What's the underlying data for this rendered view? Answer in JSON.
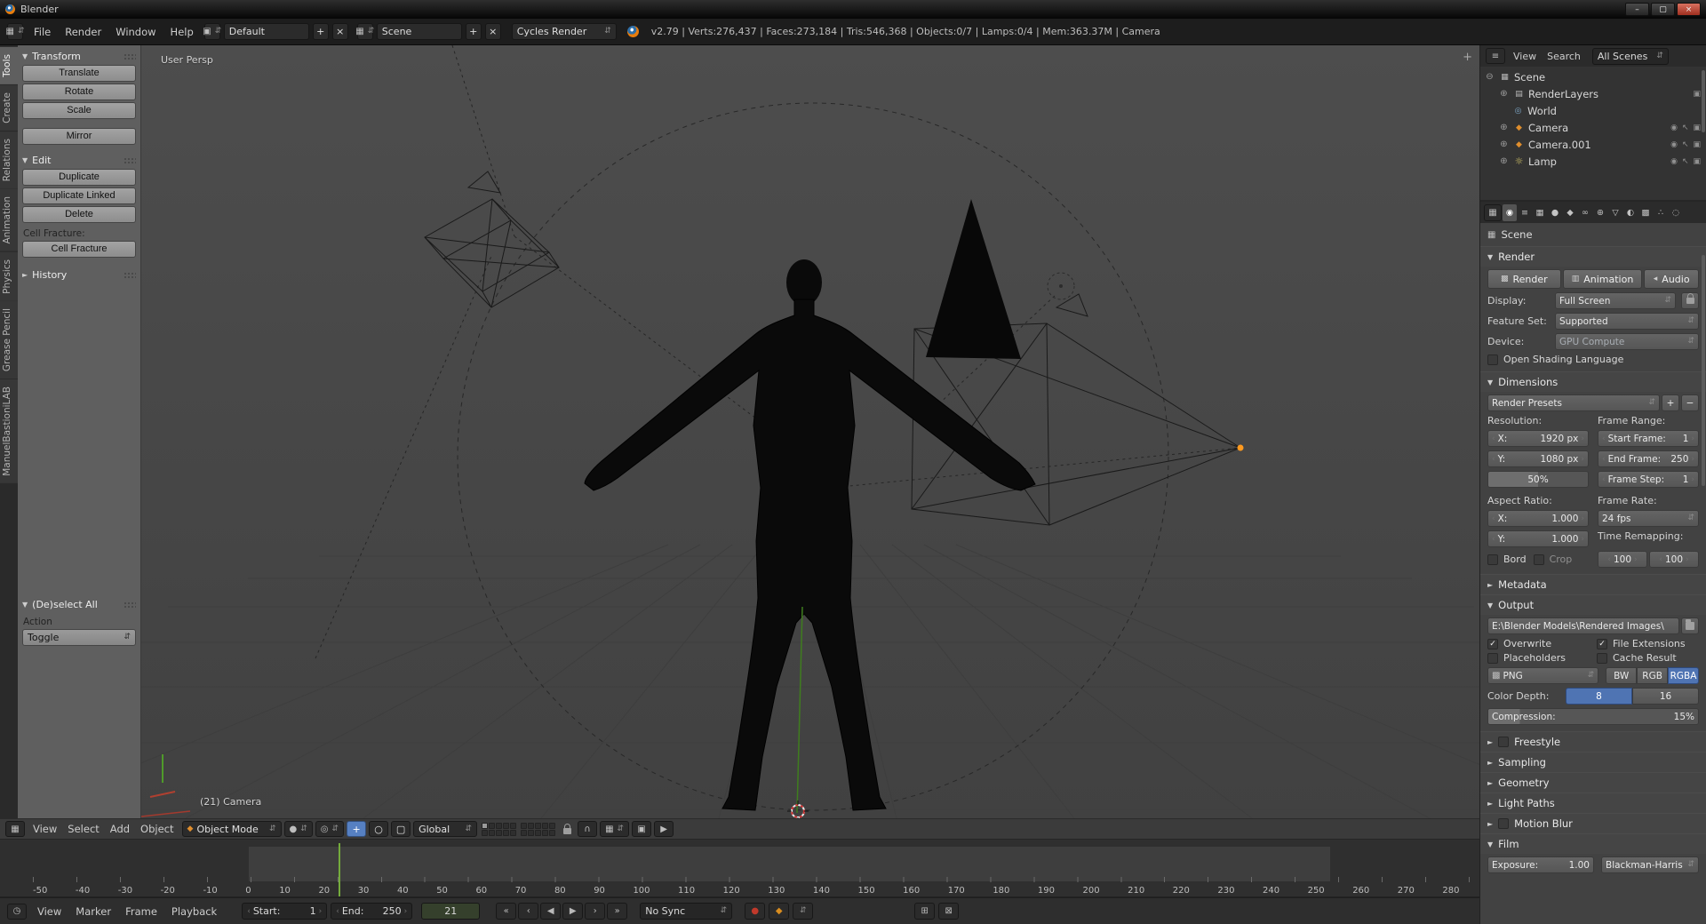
{
  "icons": {
    "updown": "⇵",
    "left": "‹",
    "right": "›",
    "check": "✓",
    "open": "▼",
    "closed": "►",
    "plus": "+",
    "minus": "−",
    "close": "×",
    "minimize": "–",
    "maximize": "▢",
    "expand": "⊕",
    "collapse": "⊖",
    "eye": "◉",
    "cursor": "↖",
    "render_restrict": "▣",
    "scene": "▦",
    "renderlayers": "▤",
    "world": "◎",
    "camera": "◆",
    "lamp": "☼",
    "editor_generic": "▦",
    "editor_timeline": "◷",
    "editor_outliner": "≡",
    "cube": "◆",
    "sphere": "●",
    "pivot": "◎",
    "manip_move": "+",
    "manip_rotate": "○",
    "manip_scale": "▢",
    "magnet": "∩",
    "snap": "▦",
    "ogl_camera": "▣",
    "ogl_anim": "▶",
    "record": "●",
    "keyframe": "◆",
    "keying": "⊞",
    "keying2": "⊠",
    "image": "▩",
    "anim_icon": "▥",
    "audio_icon": "◂"
  },
  "titlebar": {
    "title": "Blender"
  },
  "infobar": {
    "menus": [
      "File",
      "Render",
      "Window",
      "Help"
    ],
    "layout": "Default",
    "scene": "Scene",
    "engine": "Cycles Render",
    "stats": "v2.79 | Verts:276,437 | Faces:273,184 | Tris:546,368 | Objects:0/7 | Lamps:0/4 | Mem:363.37M | Camera"
  },
  "toolshelf": {
    "tabs": [
      "Tools",
      "Create",
      "Relations",
      "Animation",
      "Physics",
      "Grease Pencil",
      "ManuelBastioniLAB"
    ],
    "transform": {
      "title": "Transform",
      "buttons": [
        "Translate",
        "Rotate",
        "Scale"
      ],
      "mirror": "Mirror"
    },
    "edit": {
      "title": "Edit",
      "buttons": [
        "Duplicate",
        "Duplicate Linked",
        "Delete"
      ],
      "cell_label": "Cell Fracture:",
      "cell_btn": "Cell Fracture"
    },
    "history": "History",
    "redo": {
      "title": "(De)select All",
      "action_label": "Action",
      "value": "Toggle"
    }
  },
  "viewport": {
    "persp": "User Persp",
    "camera": "(21) Camera",
    "menus": [
      "View",
      "Select",
      "Add",
      "Object"
    ],
    "mode": "Object Mode",
    "orientation": "Global"
  },
  "timeline": {
    "ticks": [
      "-50",
      "-40",
      "-30",
      "-20",
      "-10",
      "0",
      "10",
      "20",
      "30",
      "40",
      "50",
      "60",
      "70",
      "80",
      "90",
      "100",
      "110",
      "120",
      "130",
      "140",
      "150",
      "160",
      "170",
      "180",
      "190",
      "200",
      "210",
      "220",
      "230",
      "240",
      "250",
      "260",
      "270",
      "280"
    ],
    "menus": [
      "View",
      "Marker",
      "Frame",
      "Playback"
    ],
    "start_label": "Start:",
    "start": "1",
    "end_label": "End:",
    "end": "250",
    "frame": "21",
    "playback": [
      "«",
      "‹",
      "◀",
      "▶",
      "›",
      "»"
    ],
    "sync": "No Sync"
  },
  "outliner": {
    "menus": [
      "View",
      "Search"
    ],
    "display": "All Scenes",
    "rows": [
      {
        "label": "Scene"
      },
      {
        "label": "RenderLayers"
      },
      {
        "label": "World"
      },
      {
        "label": "Camera"
      },
      {
        "label": "Camera.001"
      },
      {
        "label": "Lamp"
      }
    ]
  },
  "properties": {
    "tabs": [
      "◉",
      "≡",
      "▦",
      "●",
      "◆",
      "∞",
      "⊕",
      "▽",
      "◐",
      "▩",
      "∴",
      "◌"
    ],
    "breadcrumb": "Scene",
    "render": {
      "title": "Render",
      "render_btn": "Render",
      "animation_btn": "Animation",
      "audio_btn": "Audio",
      "display_label": "Display:",
      "display": "Full Screen",
      "feature_label": "Feature Set:",
      "feature": "Supported",
      "device_label": "Device:",
      "device": "GPU Compute",
      "osl": "Open Shading Language"
    },
    "dimensions": {
      "title": "Dimensions",
      "presets": "Render Presets",
      "resolution_label": "Resolution:",
      "frame_range_label": "Frame Range:",
      "res_x_label": "X:",
      "res_x": "1920 px",
      "res_y_label": "Y:",
      "res_y": "1080 px",
      "res_pct": "50%",
      "start_label": "Start Frame:",
      "start": "1",
      "end_label": "End Frame:",
      "end": "250",
      "step_label": "Frame Step:",
      "step": "1",
      "aspect_label": "Aspect Ratio:",
      "frame_rate_label": "Frame Rate:",
      "asp_x_label": "X:",
      "asp_x": "1.000",
      "asp_y_label": "Y:",
      "asp_y": "1.000",
      "fps": "24 fps",
      "remap_label": "Time Remapping:",
      "remap_old": "100",
      "remap_new": "100",
      "border": "Bord",
      "crop": "Crop"
    },
    "metadata": {
      "title": "Metadata"
    },
    "output": {
      "title": "Output",
      "path": "E:\\Blender Models\\Rendered Images\\",
      "overwrite": "Overwrite",
      "file_ext": "File Extensions",
      "placeholders": "Placeholders",
      "cache": "Cache Result",
      "format": "PNG",
      "bw": "BW",
      "rgb": "RGB",
      "rgba": "RGBA",
      "depth_label": "Color Depth:",
      "d8": "8",
      "d16": "16",
      "comp_label": "Compression:",
      "comp": "15%"
    },
    "collapsed": [
      "Freestyle",
      "Sampling",
      "Geometry",
      "Light Paths",
      "Motion Blur"
    ],
    "film": {
      "title": "Film",
      "exposure_label": "Exposure:",
      "exposure": "1.00",
      "filter": "Blackman-Harris"
    }
  }
}
